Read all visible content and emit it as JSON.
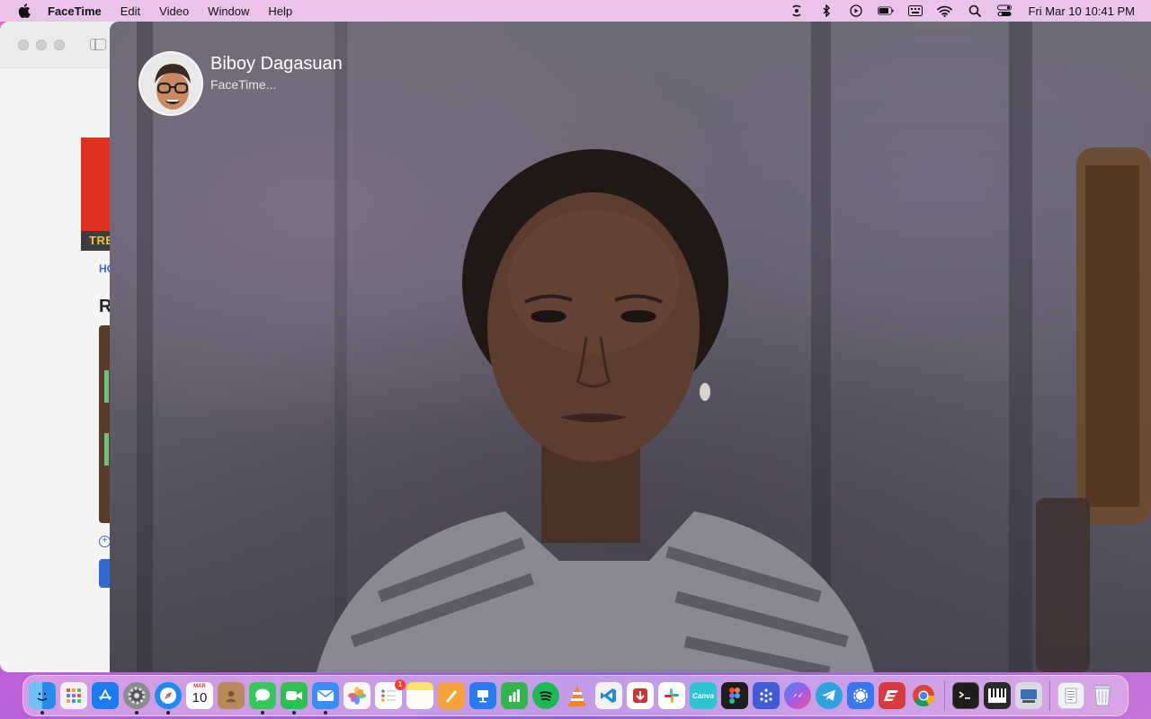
{
  "menubar": {
    "app_name": "FaceTime",
    "menus": [
      "Edit",
      "Video",
      "Window",
      "Help"
    ],
    "clock": "Fri Mar 10  10:41 PM",
    "status_icons": [
      "airdrop-icon",
      "bluetooth-icon",
      "media-play-icon",
      "battery-icon",
      "keyboard-input-icon",
      "wifi-icon",
      "spotlight-search-icon",
      "control-center-icon"
    ]
  },
  "background_window": {
    "banner_text": "TRE",
    "link_text": "HO",
    "heading_text": "R"
  },
  "call": {
    "caller_name": "Biboy Dagasuan",
    "status": "FaceTime..."
  },
  "dock": {
    "calendar_month": "MAR",
    "calendar_day": "10",
    "reminders_badge": "1",
    "apps": [
      {
        "name": "finder",
        "color": "#2c8ef0",
        "running": true
      },
      {
        "name": "launchpad",
        "color": "#e8e8ee",
        "running": false
      },
      {
        "name": "app-store",
        "color": "#1b7cf2",
        "running": false
      },
      {
        "name": "system-preferences",
        "color": "#8a8a8f",
        "running": true
      },
      {
        "name": "safari",
        "color": "#1c8cf0",
        "running": true
      },
      {
        "name": "calendar",
        "color": "#ffffff",
        "running": false
      },
      {
        "name": "contacts",
        "color": "#b8895a",
        "running": false
      },
      {
        "name": "messages",
        "color": "#34c759",
        "running": true
      },
      {
        "name": "facetime",
        "color": "#2fbf4f",
        "running": true
      },
      {
        "name": "mail",
        "color": "#3a8df5",
        "running": true
      },
      {
        "name": "photos",
        "color": "#f7f7f7",
        "running": false
      },
      {
        "name": "reminders",
        "color": "#ffffff",
        "running": false
      },
      {
        "name": "notes",
        "color": "#fbe36a",
        "running": false
      },
      {
        "name": "pages",
        "color": "#f7a23b",
        "running": false
      },
      {
        "name": "keynote",
        "color": "#2a7bf0",
        "running": false
      },
      {
        "name": "numbers",
        "color": "#33b54d",
        "running": false
      },
      {
        "name": "spotify",
        "color": "#1db954",
        "running": false
      },
      {
        "name": "vlc",
        "color": "#f58220",
        "running": false
      },
      {
        "name": "visual-studio-code",
        "color": "#f2f2f2",
        "running": false
      },
      {
        "name": "downloader",
        "color": "#ffffff",
        "running": false
      },
      {
        "name": "slack",
        "color": "#ffffff",
        "running": false
      },
      {
        "name": "canva",
        "color": "#2bc4d1",
        "running": false
      },
      {
        "name": "figma",
        "color": "#1e1e1e",
        "running": false
      },
      {
        "name": "molecule-app",
        "color": "#3f5bd8",
        "running": false
      },
      {
        "name": "messenger",
        "color": "#9b5cf0",
        "running": false
      },
      {
        "name": "telegram",
        "color": "#2aa3de",
        "running": false
      },
      {
        "name": "signal",
        "color": "#3a76f0",
        "running": false
      },
      {
        "name": "expressvpn",
        "color": "#da3940",
        "running": false
      },
      {
        "name": "chrome",
        "color": "#ffffff",
        "running": false
      }
    ],
    "utilities": [
      {
        "name": "terminal",
        "color": "#1d1d1d"
      },
      {
        "name": "piano",
        "color": "#2a2a2a"
      },
      {
        "name": "screen-utility",
        "color": "#d9d9df"
      }
    ],
    "right": [
      {
        "name": "documents-folder",
        "color": "#eef1f5"
      },
      {
        "name": "trash",
        "color": "#e4e7ec"
      }
    ]
  }
}
